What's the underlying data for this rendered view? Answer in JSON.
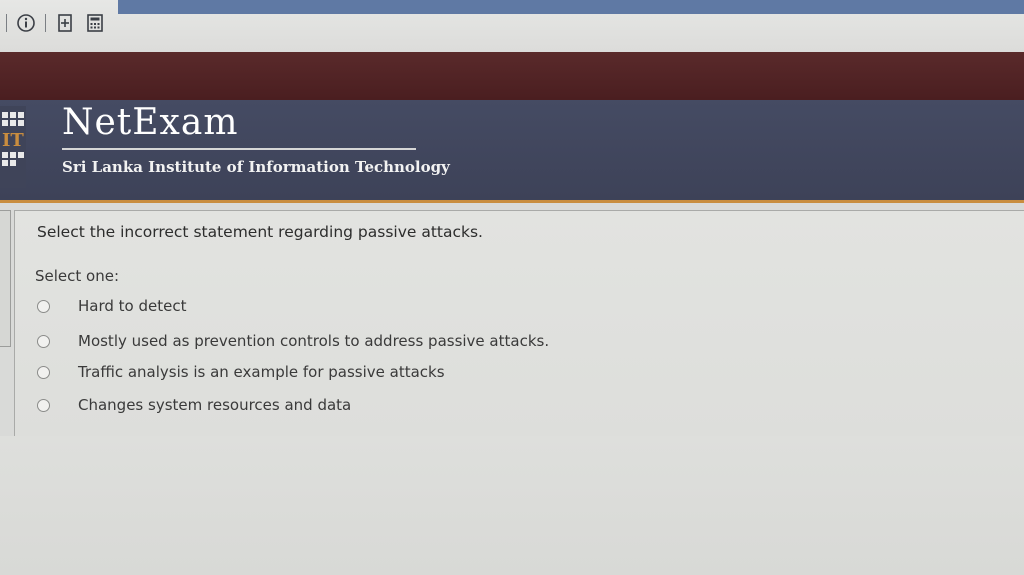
{
  "toolbar": {
    "icons": [
      "info-icon",
      "add-page-icon",
      "calculator-icon"
    ]
  },
  "header": {
    "brand": "NetExam",
    "subtitle": "Sri Lanka Institute of Information Technology",
    "logo_text": "IT"
  },
  "question": {
    "text": "Select the incorrect statement regarding passive attacks.",
    "prompt": "Select one:",
    "options": [
      "Hard to detect",
      "Mostly used as prevention controls to address passive attacks.",
      "Traffic analysis is an example for passive attacks",
      "Changes system resources and data"
    ]
  },
  "colors": {
    "header_bg": "#424860",
    "red_band": "#521f22",
    "accent_orange": "#c98d3f",
    "toolbar_blue": "#5f79a4"
  }
}
